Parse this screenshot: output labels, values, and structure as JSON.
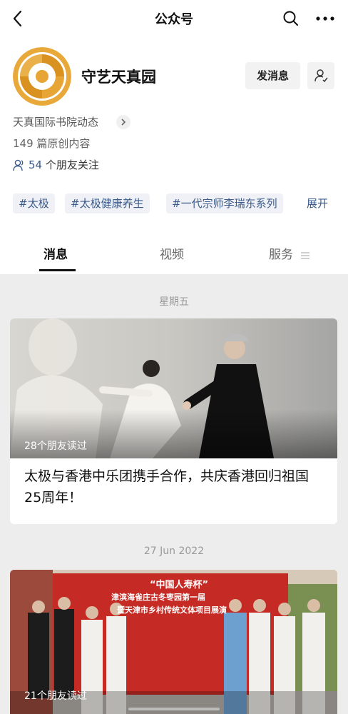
{
  "nav": {
    "title": "公众号"
  },
  "account": {
    "name": "守艺天真园",
    "send_message_label": "发消息",
    "org_link": "天真国际书院动态",
    "original_count": "149 篇原创内容",
    "friends_count": "54",
    "friends_suffix": " 个朋友关注"
  },
  "tags": [
    "#太极",
    "#太极健康养生",
    "#一代宗师李瑞东系列"
  ],
  "tags_more": "展开",
  "tabs": [
    "消息",
    "视频",
    "服务"
  ],
  "feed": [
    {
      "date": "星期五",
      "read_count": "28个朋友读过",
      "title": "太极与香港中乐团携手合作，共庆香港回归祖国25周年！"
    },
    {
      "date": "27 Jun 2022",
      "read_count": "21个朋友读过",
      "banner_title": "“中国人寿杯”",
      "banner_subtitle1": "津滨海雀庄古冬枣园第一届",
      "banner_subtitle2": "暨天津市乡村传统文体项目展演"
    }
  ],
  "colors": {
    "link": "#3b5a8a",
    "tag_bg": "#eff1f6",
    "background": "#ededed"
  }
}
